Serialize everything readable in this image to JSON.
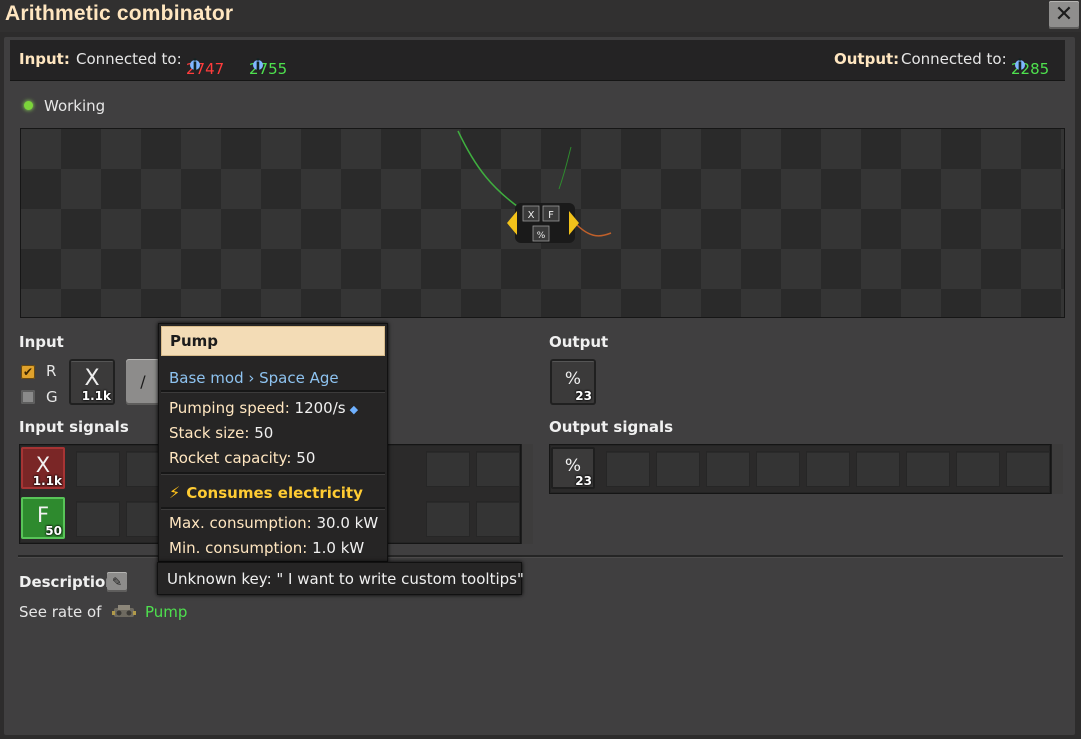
{
  "window": {
    "title": "Arithmetic combinator",
    "close_icon": "close-icon"
  },
  "connections": {
    "input_label": "Input:",
    "input_connected": "Connected to:",
    "input_red_network": "2747",
    "input_green_network": "2755",
    "output_label": "Output:",
    "output_connected": "Connected to:",
    "output_green_network": "2285"
  },
  "status": {
    "text": "Working",
    "color": "#7cd63a"
  },
  "preview": {
    "combinator_glyphs": [
      "X",
      "F",
      "%"
    ]
  },
  "input_section": {
    "label": "Input",
    "red_checkbox": {
      "label": "R",
      "checked": true
    },
    "green_checkbox": {
      "label": "G",
      "checked": false
    },
    "first_operand": {
      "glyph": "X",
      "count": "1.1k"
    },
    "operator": "/"
  },
  "output_section": {
    "label": "Output",
    "signal": {
      "glyph": "%",
      "count": "23"
    }
  },
  "input_signals": {
    "label": "Input signals",
    "signals": [
      {
        "glyph": "X",
        "count": "1.1k",
        "wire": "red"
      },
      {
        "glyph": "F",
        "count": "50",
        "wire": "green"
      }
    ]
  },
  "output_signals": {
    "label": "Output signals",
    "signals": [
      {
        "glyph": "%",
        "count": "23"
      }
    ]
  },
  "description": {
    "label": "Description",
    "text_prefix": "See rate of",
    "link_text": "Pump"
  },
  "tooltip": {
    "title": "Pump",
    "mod_path": "Base mod › Space Age",
    "pumping_speed_label": "Pumping speed:",
    "pumping_speed_value": "1200/s",
    "stack_size_label": "Stack size:",
    "stack_size_value": "50",
    "rocket_capacity_label": "Rocket capacity:",
    "rocket_capacity_value": "50",
    "electricity_label": "Consumes electricity",
    "max_consumption_label": "Max. consumption:",
    "max_consumption_value": "30.0 kW",
    "min_consumption_label": "Min. consumption:",
    "min_consumption_value": "1.0 kW"
  },
  "tooltip_description": {
    "text": "Unknown key: \" I want to write custom tooltips\""
  },
  "colors": {
    "title": "#ffe6c0",
    "red_wire": "#ff3c3c",
    "green_wire": "#4ee04e",
    "tooltip_header": "#f3dcb6"
  }
}
